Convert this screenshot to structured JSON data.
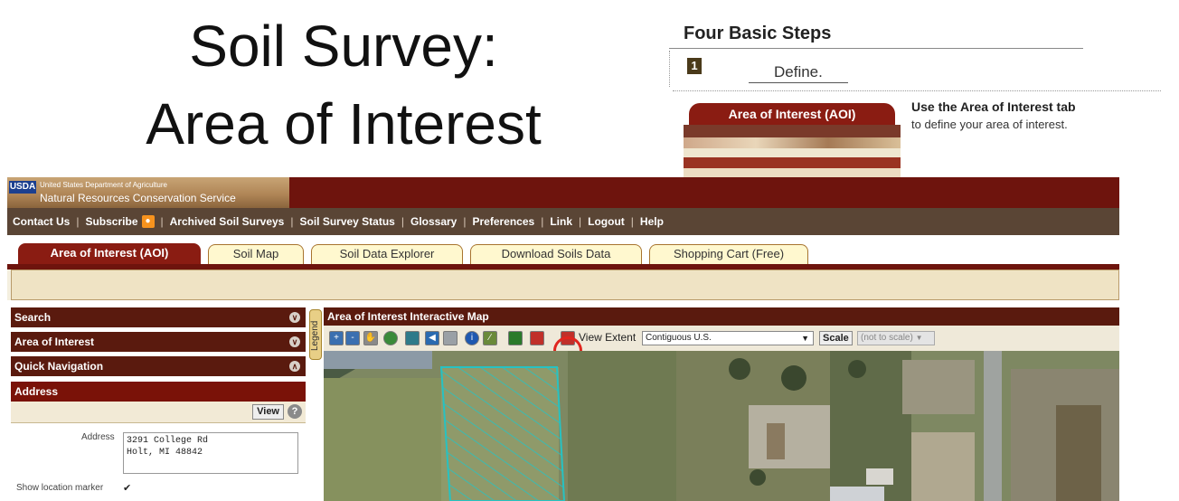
{
  "slide": {
    "title_line1": "Soil Survey:",
    "title_line2": "Area of Interest"
  },
  "steps_panel": {
    "heading": "Four Basic Steps",
    "step_number": "1",
    "step_label": "Define.",
    "mini_tab_label": "Area of Interest (AOI)",
    "hint_bold": "Use the Area of Interest tab",
    "hint_text": "to define your area of interest."
  },
  "banner": {
    "logo_text": "USDA",
    "agency_line1": "United States Department of Agriculture",
    "agency_line2": "Natural Resources Conservation Service"
  },
  "nav": {
    "items": [
      "Contact Us",
      "Subscribe",
      "Archived Soil Surveys",
      "Soil Survey Status",
      "Glossary",
      "Preferences",
      "Link",
      "Logout",
      "Help"
    ]
  },
  "tabs": [
    {
      "label": "Area of Interest (AOI)",
      "active": true
    },
    {
      "label": "Soil Map",
      "active": false
    },
    {
      "label": "Soil Data Explorer",
      "active": false
    },
    {
      "label": "Download Soils Data",
      "active": false
    },
    {
      "label": "Shopping Cart (Free)",
      "active": false
    }
  ],
  "sidebar": {
    "search_label": "Search",
    "aoi_label": "Area of Interest",
    "quicknav_label": "Quick Navigation",
    "address_header": "Address",
    "view_button": "View",
    "help_glyph": "?",
    "address_field_label": "Address",
    "address_value": "3291 College Rd\nHolt, MI 48842",
    "location_marker_label": "Show location marker",
    "location_marker_checked": "✔"
  },
  "legend": {
    "label": "Legend"
  },
  "map": {
    "header": "Area of Interest Interactive Map",
    "view_extent_label": "View Extent",
    "view_extent_value": "Contiguous U.S.",
    "scale_button": "Scale",
    "scale_value": "(not to scale)",
    "tools": [
      "zoom-in-icon",
      "zoom-out-icon",
      "pan-hand-icon",
      "globe-icon",
      "aoi-import-icon",
      "back-arrow-icon",
      "forward-arrow-icon",
      "info-icon",
      "measure-icon",
      "print-icon",
      "aoi-rectangle-icon",
      "aoi-polygon-icon"
    ],
    "tool_colors": [
      "#3a6fb0",
      "#3a6fb0",
      "#8a8a8a",
      "#3a8a3a",
      "#2e7a8a",
      "#2a6ab0",
      "#9aa0a6",
      "#1e58b0",
      "#6a8a3a",
      "#2a7a2a",
      "#c0302a",
      "#c0302a"
    ]
  },
  "colors": {
    "banner_red": "#6e140d",
    "nav_brown": "#5a4535",
    "active_tab": "#8a1c12",
    "highlight_ring": "#e0261f",
    "aoi_polygon": "#27c2c2"
  }
}
